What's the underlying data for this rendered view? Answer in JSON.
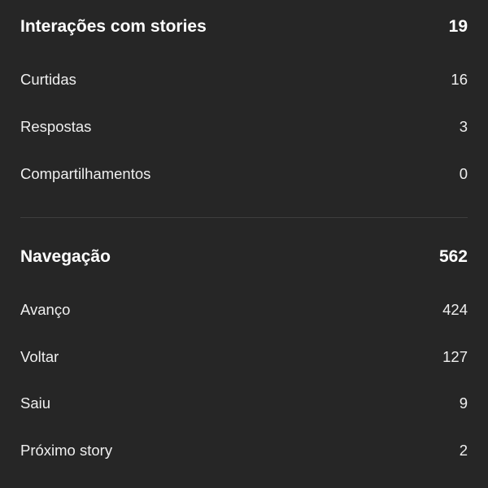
{
  "stories_interactions": {
    "title": "Interações com stories",
    "total": "19",
    "items": [
      {
        "label": "Curtidas",
        "value": "16"
      },
      {
        "label": "Respostas",
        "value": "3"
      },
      {
        "label": "Compartilhamentos",
        "value": "0"
      }
    ]
  },
  "navigation": {
    "title": "Navegação",
    "total": "562",
    "items": [
      {
        "label": "Avanço",
        "value": "424"
      },
      {
        "label": "Voltar",
        "value": "127"
      },
      {
        "label": "Saiu",
        "value": "9"
      },
      {
        "label": "Próximo story",
        "value": "2"
      }
    ]
  },
  "colors": {
    "background": "#262626",
    "text": "#f5f5f5",
    "divider": "#3d3d3d"
  }
}
